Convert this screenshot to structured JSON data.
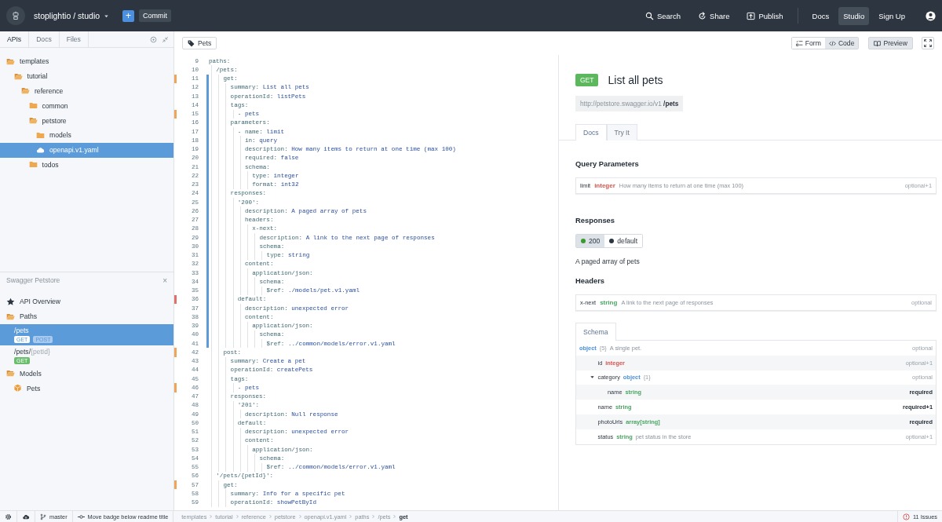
{
  "topbar": {
    "project": "stoplightio / studio",
    "add_button": "+",
    "commit_button": "Commit",
    "actions": [
      {
        "kind": "search",
        "label": "Search"
      },
      {
        "kind": "share",
        "label": "Share"
      },
      {
        "kind": "publish",
        "label": "Publish"
      }
    ],
    "nav": [
      {
        "label": "Docs",
        "selected": false
      },
      {
        "label": "Studio",
        "selected": true
      },
      {
        "label": "Sign Up",
        "selected": false
      }
    ]
  },
  "sidebar": {
    "tabs": [
      {
        "label": "APIs",
        "selected": true
      },
      {
        "label": "Docs",
        "selected": false
      },
      {
        "label": "Files",
        "selected": false
      }
    ],
    "file_tree": [
      {
        "name": "templates",
        "kind": "folder",
        "expanded": true,
        "selected": false,
        "children": [
          {
            "name": "tutorial",
            "kind": "folder",
            "expanded": true,
            "selected": false,
            "children": [
              {
                "name": "reference",
                "kind": "folder",
                "expanded": true,
                "selected": false,
                "children": [
                  {
                    "name": "common",
                    "kind": "folder",
                    "expanded": false,
                    "selected": false
                  },
                  {
                    "name": "petstore",
                    "kind": "folder",
                    "expanded": true,
                    "selected": false,
                    "children": [
                      {
                        "name": "models",
                        "kind": "folder",
                        "expanded": false,
                        "selected": false
                      },
                      {
                        "name": "openapi.v1.yaml",
                        "kind": "api",
                        "selected": true
                      }
                    ]
                  },
                  {
                    "name": "todos",
                    "kind": "folder",
                    "expanded": false,
                    "selected": false
                  }
                ]
              }
            ]
          }
        ]
      }
    ],
    "outline": {
      "title": "Swagger Petstore",
      "close": "×",
      "items": [
        {
          "kind": "overview",
          "label": "API Overview",
          "selected": false
        },
        {
          "kind": "folder",
          "label": "Paths",
          "selected": false
        },
        {
          "kind": "path",
          "path": "/pets",
          "methods": [
            {
              "label": "GET"
            },
            {
              "label": "POST"
            }
          ],
          "selected": true
        },
        {
          "kind": "path",
          "path": "/pets/",
          "param": "{petId}",
          "methods": [
            {
              "label": "GET",
              "color": "#6bbd6e"
            }
          ],
          "selected": false
        },
        {
          "kind": "folder",
          "label": "Models",
          "selected": false
        },
        {
          "kind": "model",
          "label": "Pets",
          "selected": false
        }
      ]
    }
  },
  "toolbar": {
    "tag_button": "Pets",
    "views": [
      {
        "label": "Form",
        "kind": "form",
        "selected": false
      },
      {
        "label": "Code",
        "kind": "code",
        "selected": true
      }
    ],
    "preview": {
      "label": "Preview",
      "on": true
    }
  },
  "editor": {
    "lines": [
      {
        "number": "9",
        "key": "paths:",
        "active": false,
        "children": [
          {
            "number": "10",
            "key": "/pets:",
            "active": false,
            "children": [
              {
                "number": "11",
                "key": "get:",
                "active": true,
                "color": "#f0a45a",
                "children": [
                  {
                    "number": "12",
                    "key": "summary:",
                    "value": "List all pets",
                    "active": true
                  },
                  {
                    "number": "13",
                    "key": "operationId:",
                    "value": "listPets",
                    "active": true
                  },
                  {
                    "number": "14",
                    "key": "tags:",
                    "active": true,
                    "children": [
                      {
                        "number": "15",
                        "key": "-",
                        "value": "pets",
                        "active": true,
                        "color": "#f0a45a"
                      }
                    ]
                  },
                  {
                    "number": "16",
                    "key": "parameters:",
                    "active": true,
                    "children": [
                      {
                        "number": "17",
                        "key": "- name:",
                        "value": "limit",
                        "active": true,
                        "children": [
                          {
                            "number": "18",
                            "key": "in:",
                            "value": "query",
                            "active": true
                          },
                          {
                            "number": "19",
                            "key": "description:",
                            "value": "How many items to return at one time (max 100)",
                            "active": true
                          },
                          {
                            "number": "20",
                            "key": "required:",
                            "value": "false",
                            "active": true
                          },
                          {
                            "number": "21",
                            "key": "schema:",
                            "active": true,
                            "children": [
                              {
                                "number": "22",
                                "key": "type:",
                                "value": "integer",
                                "active": true
                              },
                              {
                                "number": "23",
                                "key": "format:",
                                "value": "int32",
                                "active": true
                              }
                            ]
                          }
                        ]
                      }
                    ]
                  },
                  {
                    "number": "24",
                    "key": "responses:",
                    "active": true,
                    "children": [
                      {
                        "number": "25",
                        "key": "'200':",
                        "active": true,
                        "children": [
                          {
                            "number": "26",
                            "key": "description:",
                            "value": "A paged array of pets",
                            "active": true
                          },
                          {
                            "number": "27",
                            "key": "headers:",
                            "active": true,
                            "children": [
                              {
                                "number": "28",
                                "key": "x-next:",
                                "active": true,
                                "children": [
                                  {
                                    "number": "29",
                                    "key": "description:",
                                    "value": "A link to the next page of responses",
                                    "active": true
                                  },
                                  {
                                    "number": "30",
                                    "key": "schema:",
                                    "active": true,
                                    "children": [
                                      {
                                        "number": "31",
                                        "key": "type:",
                                        "value": "string",
                                        "active": true
                                      }
                                    ]
                                  }
                                ]
                              }
                            ]
                          },
                          {
                            "number": "32",
                            "key": "content:",
                            "active": true,
                            "children": [
                              {
                                "number": "33",
                                "key": "application/json:",
                                "active": true,
                                "children": [
                                  {
                                    "number": "34",
                                    "key": "schema:",
                                    "active": true,
                                    "children": [
                                      {
                                        "number": "35",
                                        "key": "$ref:",
                                        "value": "./models/pet.v1.yaml",
                                        "active": true
                                      }
                                    ]
                                  }
                                ]
                              }
                            ]
                          }
                        ]
                      },
                      {
                        "number": "36",
                        "key": "default:",
                        "active": true,
                        "color": "#e2706a",
                        "children": [
                          {
                            "number": "37",
                            "key": "description:",
                            "value": "unexpected error",
                            "active": true
                          },
                          {
                            "number": "38",
                            "key": "content:",
                            "active": true,
                            "children": [
                              {
                                "number": "39",
                                "key": "application/json:",
                                "active": true,
                                "children": [
                                  {
                                    "number": "40",
                                    "key": "schema:",
                                    "active": true,
                                    "children": [
                                      {
                                        "number": "41",
                                        "key": "$ref:",
                                        "value": "../common/models/error.v1.yaml",
                                        "active": true
                                      }
                                    ]
                                  }
                                ]
                              }
                            ]
                          }
                        ]
                      }
                    ]
                  }
                ]
              },
              {
                "number": "42",
                "key": "post:",
                "active": false,
                "color": "#f0a45a",
                "children": [
                  {
                    "number": "43",
                    "key": "summary:",
                    "value": "Create a pet",
                    "active": false
                  },
                  {
                    "number": "44",
                    "key": "operationId:",
                    "value": "createPets",
                    "active": false
                  },
                  {
                    "number": "45",
                    "key": "tags:",
                    "active": false,
                    "children": [
                      {
                        "number": "46",
                        "key": "-",
                        "value": "pets",
                        "active": false,
                        "color": "#f0a45a"
                      }
                    ]
                  },
                  {
                    "number": "47",
                    "key": "responses:",
                    "active": false,
                    "children": [
                      {
                        "number": "48",
                        "key": "'201':",
                        "active": false,
                        "children": [
                          {
                            "number": "49",
                            "key": "description:",
                            "value": "Null response",
                            "active": false
                          }
                        ]
                      },
                      {
                        "number": "50",
                        "key": "default:",
                        "active": false,
                        "children": [
                          {
                            "number": "51",
                            "key": "description:",
                            "value": "unexpected error",
                            "active": false
                          },
                          {
                            "number": "52",
                            "key": "content:",
                            "active": false,
                            "children": [
                              {
                                "number": "53",
                                "key": "application/json:",
                                "active": false,
                                "children": [
                                  {
                                    "number": "54",
                                    "key": "schema:",
                                    "active": false,
                                    "children": [
                                      {
                                        "number": "55",
                                        "key": "$ref:",
                                        "value": "../common/models/error.v1.yaml",
                                        "active": false
                                      }
                                    ]
                                  }
                                ]
                              }
                            ]
                          }
                        ]
                      }
                    ]
                  }
                ]
              }
            ]
          },
          {
            "number": "56",
            "key": "'/pets/{petId}':",
            "active": false,
            "children": [
              {
                "number": "57",
                "key": "get:",
                "active": false,
                "color": "#f0a45a",
                "children": [
                  {
                    "number": "58",
                    "key": "summary:",
                    "value": "Info for a specific pet",
                    "active": false
                  },
                  {
                    "number": "59",
                    "key": "operationId:",
                    "value": "showPetById",
                    "active": false
                  }
                ]
              }
            ]
          }
        ]
      }
    ]
  },
  "doc": {
    "method": "GET",
    "title": "List all pets",
    "base_url": "http://petstore.swagger.io/v1",
    "path": "/pets",
    "tabs": [
      {
        "label": "Docs",
        "selected": true
      },
      {
        "label": "Try It",
        "selected": false
      }
    ],
    "query_heading": "Query Parameters",
    "query_params": [
      {
        "name": "limit",
        "type": "integer",
        "color": "#d9534f",
        "description": "How many items to return at one time (max 100)",
        "requirement": "optional+1",
        "required": false
      }
    ],
    "responses_heading": "Responses",
    "responses": [
      {
        "label": "200",
        "color": "#3a9a2e",
        "selected": true
      },
      {
        "label": "default",
        "color": "#2d3640",
        "selected": false
      }
    ],
    "response_description": "A paged array of pets",
    "headers_heading": "Headers",
    "headers": [
      {
        "name": "x-next",
        "type": "string",
        "color": "#4aa564",
        "description": "A link to the next page of responses",
        "requirement": "optional",
        "required": false
      }
    ],
    "schema_tab": "Schema",
    "schema": [
      {
        "type": "object",
        "color": "#4a90d9",
        "count": "{5}",
        "description": "A single pet.",
        "requirement": "optional",
        "required": false,
        "children": [
          {
            "name": "id",
            "type": "integer",
            "color": "#d9534f",
            "requirement": "optional+1",
            "required": false
          },
          {
            "name": "category",
            "type": "object",
            "color": "#4a90d9",
            "count": "{1}",
            "requirement": "optional",
            "required": false,
            "expanded": true,
            "children": [
              {
                "name": "name",
                "type": "string",
                "color": "#4aa564",
                "requirement": "required",
                "required": true
              }
            ]
          },
          {
            "name": "name",
            "type": "string",
            "color": "#4aa564",
            "requirement": "required+1",
            "required": true
          },
          {
            "name": "photoUrls",
            "type": "array[string]",
            "color": "#4aa564",
            "requirement": "required",
            "required": true
          },
          {
            "name": "status",
            "type": "string",
            "color": "#4aa564",
            "description": "pet status in the store",
            "requirement": "optional+1",
            "required": false
          }
        ]
      }
    ]
  },
  "status_bar": {
    "branch": "master",
    "commit": "Move badge below readme title",
    "breadcrumbs": [
      {
        "label": "templates",
        "current": false
      },
      {
        "label": "tutorial",
        "current": false
      },
      {
        "label": "reference",
        "current": false
      },
      {
        "label": "petstore",
        "current": false
      },
      {
        "label": "openapi.v1.yaml",
        "current": false
      },
      {
        "label": "paths",
        "current": false
      },
      {
        "label": "/pets",
        "current": false
      },
      {
        "label": "get",
        "current": true
      }
    ],
    "issues": "11 Issues"
  }
}
